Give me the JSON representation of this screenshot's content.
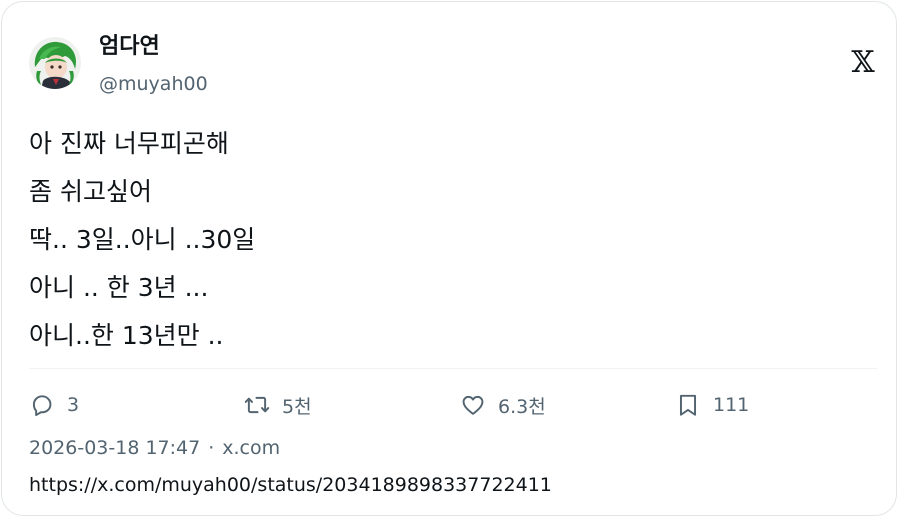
{
  "author": {
    "display_name": "엄다연",
    "handle": "@muyah00"
  },
  "brand": {
    "logo_icon": "x-logo-icon"
  },
  "tweet": {
    "lines": [
      "아 진짜 너무피곤해",
      "좀 쉬고싶어",
      "딱.. 3일..아니 ..30일",
      "아니 .. 한 3년 ...",
      "아니..한 13년만 .."
    ]
  },
  "actions": {
    "reply": {
      "icon": "reply-icon",
      "count": "3"
    },
    "retweet": {
      "icon": "retweet-icon",
      "count": "5천"
    },
    "like": {
      "icon": "heart-icon",
      "count": "6.3천"
    },
    "bookmark": {
      "icon": "bookmark-icon",
      "count": "111"
    }
  },
  "meta": {
    "timestamp": "2026-03-18 17:47",
    "separator": "·",
    "source": "x.com"
  },
  "url": "https://x.com/muyah00/status/2034189898337722411",
  "colors": {
    "text_primary": "#0f1419",
    "text_secondary": "#536471",
    "border": "#e1e5e8",
    "avatar_hair": "#2f9a3a"
  }
}
